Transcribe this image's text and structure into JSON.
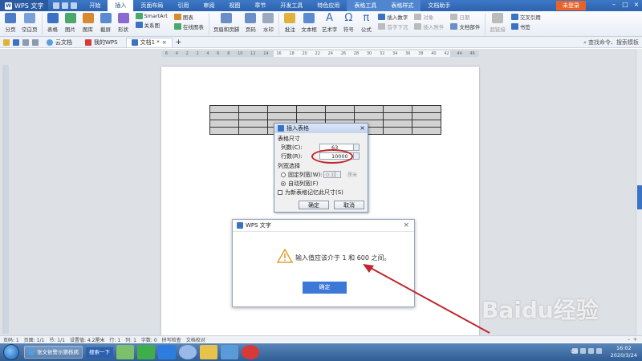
{
  "app": {
    "name": "WPS 文字",
    "menu_tabs": [
      "开始",
      "插入",
      "页面布局",
      "引用",
      "审阅",
      "视图",
      "章节",
      "开发工具",
      "特色应用",
      "表格工具",
      "表格样式",
      "文档助手"
    ],
    "active_tab": "插入",
    "login_label": "未登录"
  },
  "ribbon": {
    "items": [
      {
        "label": "分页",
        "icon": "page-break-icon",
        "color": "#4a7cc8"
      },
      {
        "label": "空白页",
        "icon": "blank-page-icon",
        "color": "#7aa0d8"
      },
      {
        "label": "表格",
        "icon": "table-icon",
        "color": "#3b73c4"
      },
      {
        "label": "图片",
        "icon": "picture-icon",
        "color": "#4aa86a"
      },
      {
        "label": "图库",
        "icon": "gallery-icon",
        "color": "#d88a2f"
      },
      {
        "label": "截屏",
        "icon": "screenshot-icon",
        "color": "#5a8ad0"
      },
      {
        "label": "形状",
        "icon": "shape-icon",
        "color": "#8a6ad0"
      }
    ],
    "stack1": [
      "SmartArt",
      "关系图"
    ],
    "stack2": [
      "图表",
      "在线图表"
    ],
    "items2": [
      {
        "label": "页眉和页脚",
        "icon": "header-footer-icon",
        "color": "#6a8fc8"
      },
      {
        "label": "页码",
        "icon": "page-number-icon",
        "color": "#6a8fc8"
      },
      {
        "label": "水印",
        "icon": "watermark-icon",
        "color": "#9aa8c0"
      },
      {
        "label": "批注",
        "icon": "comment-icon",
        "color": "#e0b23a"
      },
      {
        "label": "文本框",
        "icon": "textbox-icon",
        "color": "#5a8ad0"
      }
    ],
    "art_label": "艺术字",
    "symbol_label": "符号",
    "formula_label": "公式",
    "stack3": [
      "插入数字",
      "首字下沉",
      "对象"
    ],
    "stack4": [
      "插入附件",
      "日期",
      "文档部件"
    ],
    "hyperlink_label": "超链接",
    "crossref_label": "交叉引用",
    "bookmark_label": "书签"
  },
  "tabbar": {
    "tabs": [
      "云文档",
      "我的WPS",
      "文档1 *"
    ],
    "search_placeholder": "查找命令、搜索模板"
  },
  "ruler": {
    "numbers": [
      "6",
      "4",
      "2",
      "2",
      "4",
      "6",
      "8",
      "10",
      "12",
      "14",
      "16",
      "18",
      "20",
      "22",
      "24",
      "26",
      "28",
      "30",
      "32",
      "34",
      "36",
      "38",
      "40",
      "42",
      "44",
      "46"
    ]
  },
  "insert_table_dialog": {
    "title": "插入表格",
    "section_size": "表格尺寸",
    "cols_label": "列数(C):",
    "cols_value": "63",
    "rows_label": "行数(R):",
    "rows_value": "10000",
    "section_col": "列宽选择",
    "fixed_label": "固定列宽(W):",
    "fixed_value": "0.16",
    "fixed_unit": "厘米",
    "auto_label": "自动列宽(F)",
    "remember_label": "为新表格记忆此尺寸(S)",
    "ok_label": "确定",
    "cancel_label": "取消"
  },
  "alert_dialog": {
    "title": "WPS 文字",
    "message": "输入值应该介于 1 和 600 之间。",
    "ok_label": "确定"
  },
  "statusbar": {
    "items": [
      "页码: 1",
      "页面: 1/1",
      "节: 1/1",
      "设置值: 4.2厘米",
      "行: 1",
      "列: 1",
      "字数: 0",
      "拼写检查",
      "文档校对"
    ]
  },
  "taskbar": {
    "item1": "张文依警示猜核病",
    "search": "搜索一下",
    "time": "16:02",
    "date": "2020/3/24",
    "lang": "CH"
  },
  "watermark": "Baidu经验"
}
